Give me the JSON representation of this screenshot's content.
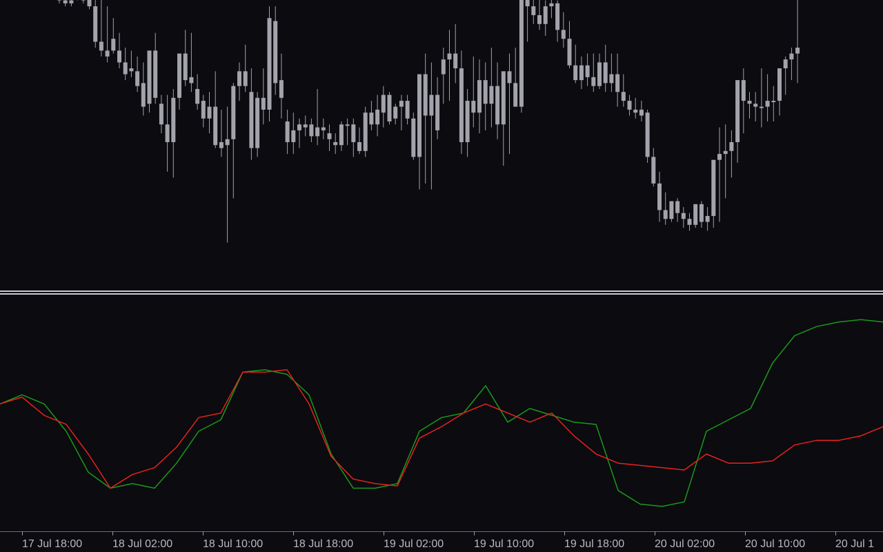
{
  "colors": {
    "background": "#0b0b10",
    "candle": "#a3a3ab",
    "separator": "#c9c9d0",
    "axis_text": "#b9b9c2",
    "green_line": "#1a9a1a",
    "red_line": "#e8221c"
  },
  "chart_data": [
    {
      "type": "candlestick",
      "pane": "price",
      "title": "",
      "grid": false,
      "note_values": "price units are relative (no price scale visible); values expressed on a 0-100 normalized scale where 100 = top of price pane",
      "candles": [
        [
          99,
          99,
          97,
          98
        ],
        [
          98,
          99,
          96,
          97
        ],
        [
          98,
          99,
          96,
          97
        ],
        [
          99,
          100,
          98,
          99
        ],
        [
          99,
          100,
          97,
          98
        ],
        [
          100,
          100,
          95,
          96
        ],
        [
          96,
          100,
          82,
          84
        ],
        [
          84,
          99,
          79,
          81
        ],
        [
          81,
          96,
          77,
          79
        ],
        [
          85,
          92,
          80,
          81
        ],
        [
          81,
          87,
          75,
          77
        ],
        [
          77,
          82,
          71,
          73
        ],
        [
          75,
          81,
          72,
          74
        ],
        [
          74,
          79,
          67,
          69
        ],
        [
          70,
          77,
          59,
          62
        ],
        [
          63,
          81,
          60,
          81
        ],
        [
          81,
          87,
          63,
          65
        ],
        [
          63,
          66,
          53,
          56
        ],
        [
          56,
          66,
          40,
          50
        ],
        [
          50,
          68,
          38,
          65
        ],
        [
          65,
          80,
          61,
          80
        ],
        [
          80,
          88,
          69,
          71
        ],
        [
          72,
          87,
          67,
          70
        ],
        [
          68,
          73,
          61,
          63
        ],
        [
          64,
          66,
          55,
          58
        ],
        [
          58,
          67,
          53,
          62
        ],
        [
          62,
          74,
          48,
          49
        ],
        [
          50,
          61,
          45,
          48
        ],
        [
          49,
          62,
          16,
          51
        ],
        [
          51,
          70,
          31,
          69
        ],
        [
          69,
          77,
          64,
          74
        ],
        [
          74,
          83,
          67,
          69
        ],
        [
          67,
          75,
          44,
          48
        ],
        [
          48,
          67,
          45,
          65
        ],
        [
          65,
          75,
          56,
          61
        ],
        [
          61,
          96,
          57,
          92
        ],
        [
          91,
          96,
          66,
          70
        ],
        [
          71,
          80,
          58,
          65
        ],
        [
          57,
          61,
          46,
          50
        ],
        [
          50,
          60,
          46,
          54
        ],
        [
          54,
          58,
          48,
          56
        ],
        [
          56,
          59,
          52,
          55
        ],
        [
          56,
          58,
          50,
          52
        ],
        [
          52,
          68,
          49,
          55
        ],
        [
          55,
          58,
          51,
          54
        ],
        [
          53,
          56,
          47,
          51
        ],
        [
          50,
          53,
          46,
          49
        ],
        [
          49,
          57,
          47,
          56
        ],
        [
          56,
          58,
          49,
          56
        ],
        [
          56,
          58,
          45,
          50
        ],
        [
          50,
          55,
          46,
          47
        ],
        [
          47,
          62,
          45,
          60
        ],
        [
          60,
          64,
          54,
          56
        ],
        [
          56,
          66,
          52,
          61
        ],
        [
          60,
          69,
          55,
          66
        ],
        [
          66,
          67,
          56,
          57
        ],
        [
          58,
          63,
          56,
          62
        ],
        [
          62,
          66,
          54,
          64
        ],
        [
          64,
          66,
          56,
          58
        ],
        [
          58,
          60,
          44,
          45
        ],
        [
          45,
          70,
          34,
          73
        ],
        [
          73,
          80,
          36,
          59
        ],
        [
          59,
          77,
          34,
          66
        ],
        [
          66,
          72,
          51,
          54
        ],
        [
          73,
          82,
          63,
          78
        ],
        [
          78,
          88,
          64,
          80
        ],
        [
          80,
          90,
          70,
          75
        ],
        [
          75,
          81,
          46,
          50
        ],
        [
          50,
          68,
          45,
          64
        ],
        [
          64,
          79,
          55,
          60
        ],
        [
          60,
          78,
          53,
          71
        ],
        [
          71,
          77,
          54,
          63
        ],
        [
          63,
          82,
          55,
          69
        ],
        [
          69,
          77,
          51,
          56
        ],
        [
          56,
          71,
          42,
          74
        ],
        [
          74,
          80,
          46,
          70
        ],
        [
          70,
          82,
          62,
          62
        ],
        [
          62,
          101,
          60,
          101
        ],
        [
          101,
          102,
          84,
          96
        ],
        [
          96,
          101,
          90,
          93
        ],
        [
          93,
          100,
          88,
          90
        ],
        [
          90,
          98,
          86,
          96
        ],
        [
          96,
          102,
          92,
          97
        ],
        [
          97,
          98,
          84,
          88
        ],
        [
          88,
          94,
          82,
          85
        ],
        [
          85,
          91,
          75,
          76
        ],
        [
          76,
          83,
          70,
          71
        ],
        [
          71,
          79,
          68,
          76
        ],
        [
          76,
          80,
          69,
          72
        ],
        [
          72,
          80,
          67,
          69
        ],
        [
          69,
          80,
          68,
          77
        ],
        [
          77,
          83,
          67,
          70
        ],
        [
          70,
          80,
          67,
          73
        ],
        [
          73,
          80,
          62,
          67
        ],
        [
          67,
          73,
          62,
          64
        ],
        [
          64,
          66,
          59,
          61
        ],
        [
          61,
          65,
          58,
          60
        ],
        [
          61,
          64,
          57,
          59
        ],
        [
          60,
          61,
          43,
          45
        ],
        [
          45,
          48,
          35,
          36
        ],
        [
          36,
          40,
          23,
          27
        ],
        [
          27,
          33,
          22,
          24
        ],
        [
          24,
          30,
          23,
          30
        ],
        [
          30,
          31,
          23,
          26
        ],
        [
          26,
          28,
          21,
          24
        ],
        [
          24,
          26,
          20,
          22
        ],
        [
          22,
          29,
          21,
          29
        ],
        [
          29,
          30,
          21,
          23
        ],
        [
          23,
          28,
          20,
          25
        ],
        [
          25,
          40,
          21,
          44
        ],
        [
          44,
          55,
          23,
          46
        ],
        [
          46,
          56,
          31,
          47
        ],
        [
          47,
          54,
          38,
          50
        ],
        [
          50,
          71,
          43,
          71
        ],
        [
          71,
          75,
          53,
          64
        ],
        [
          64,
          67,
          58,
          63
        ],
        [
          63,
          67,
          57,
          62
        ],
        [
          62,
          75,
          55,
          62
        ],
        [
          62,
          73,
          57,
          64
        ],
        [
          64,
          69,
          57,
          64
        ],
        [
          64,
          73,
          59,
          75
        ],
        [
          75,
          79,
          66,
          78
        ],
        [
          78,
          82,
          71,
          80
        ],
        [
          80,
          104,
          70,
          82
        ]
      ]
    },
    {
      "type": "line",
      "pane": "indicator",
      "title": "",
      "xlabel": "",
      "ylabel": "",
      "grid": false,
      "x_tick_labels": [
        "17 Jul 18:00",
        "18 Jul 02:00",
        "18 Jul 10:00",
        "18 Jul 18:00",
        "19 Jul 02:00",
        "19 Jul 10:00",
        "19 Jul 18:00",
        "20 Jul 02:00",
        "20 Jul 10:00",
        "20 Jul 1"
      ],
      "x": [
        0,
        0.25,
        0.5,
        0.75,
        1,
        1.25,
        1.5,
        1.75,
        2,
        2.25,
        2.5,
        2.75,
        3,
        3.25,
        3.5,
        3.75,
        4,
        4.25,
        4.5,
        4.75,
        5,
        5.25,
        5.5,
        5.75,
        6,
        6.25,
        6.5,
        6.75,
        7,
        7.25,
        7.5,
        7.75,
        8,
        8.25,
        8.5,
        8.75,
        9,
        9.25,
        9.5,
        9.75,
        10
      ],
      "series": [
        {
          "color": "#1a9a1a",
          "values": [
            52,
            56,
            52,
            40,
            22,
            15,
            17,
            15,
            26,
            40,
            45,
            66,
            67,
            65,
            56,
            30,
            15,
            15,
            17,
            40,
            46,
            48,
            60,
            44,
            50,
            47,
            44,
            43,
            14,
            8,
            7,
            9,
            40,
            45,
            50,
            70,
            82,
            86,
            88,
            89,
            88
          ]
        },
        {
          "color": "#e8221c",
          "values": [
            52,
            55,
            47,
            43,
            30,
            15,
            21,
            24,
            33,
            46,
            48,
            66,
            66,
            67,
            52,
            29,
            19,
            17,
            16,
            37,
            42,
            48,
            52,
            48,
            44,
            48,
            38,
            30,
            26,
            25,
            24,
            23,
            30,
            26,
            26,
            27,
            34,
            36,
            36,
            38,
            42
          ]
        }
      ]
    }
  ]
}
